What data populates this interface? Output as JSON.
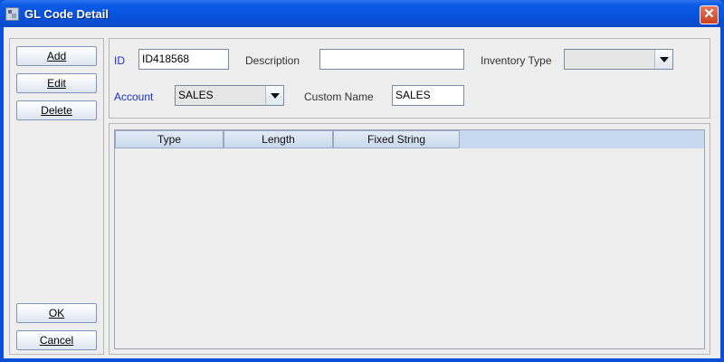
{
  "window": {
    "title": "GL Code Detail",
    "close_glyph": "✕"
  },
  "buttons": {
    "add": "Add",
    "edit": "Edit",
    "delete": "Delete",
    "ok": "OK",
    "cancel": "Cancel"
  },
  "form": {
    "id_label": "ID",
    "id_value": "ID418568",
    "description_label": "Description",
    "description_value": "",
    "inventory_type_label": "Inventory Type",
    "inventory_type_value": "",
    "account_label": "Account",
    "account_value": "SALES",
    "custom_name_label": "Custom Name",
    "custom_name_value": "SALES"
  },
  "table": {
    "columns": [
      "Type",
      "Length",
      "Fixed String"
    ],
    "rows": []
  },
  "colors": {
    "title_bar": "#0a5ae6",
    "label_accent": "#1a2fc8",
    "table_header": "#c6d9ef"
  },
  "icons": [
    "app-icon",
    "close-icon",
    "dropdown-arrow-icon"
  ]
}
